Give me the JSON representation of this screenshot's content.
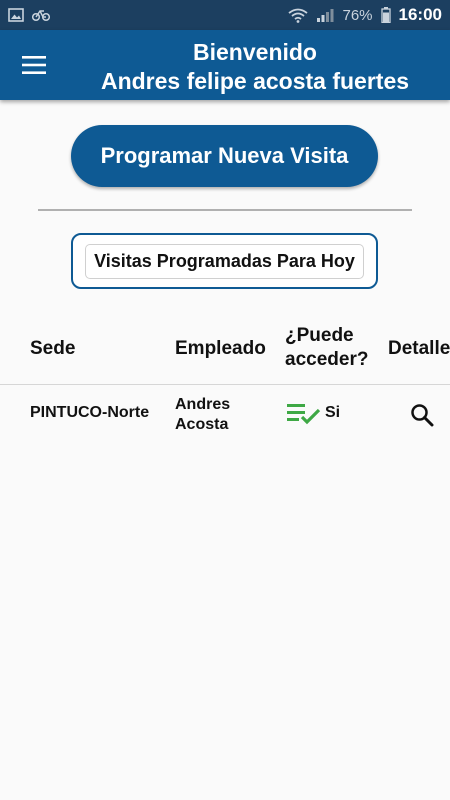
{
  "status_bar": {
    "battery": "76%",
    "time": "16:00"
  },
  "appbar": {
    "greeting": "Bienvenido",
    "user_name": "Andres felipe acosta fuertes"
  },
  "actions": {
    "new_visit_label": "Programar Nueva Visita"
  },
  "section": {
    "title": "Visitas Programadas Para Hoy"
  },
  "table": {
    "columns": {
      "sede": "Sede",
      "empleado": "Empleado",
      "acceso_line1": "¿Puede",
      "acceso_line2": "acceder?",
      "detalle": "Detalle"
    },
    "rows": [
      {
        "sede": "PINTUCO-Norte",
        "empleado_line1": "Andres",
        "empleado_line2": "Acosta",
        "acceso": "Si"
      }
    ]
  },
  "colors": {
    "primary": "#0e5a94",
    "status_bar": "#1c3f60",
    "check_green": "#3ea845"
  },
  "icons": {
    "menu": "menu-icon",
    "access": "playlist-check-icon",
    "detail": "search-icon"
  }
}
